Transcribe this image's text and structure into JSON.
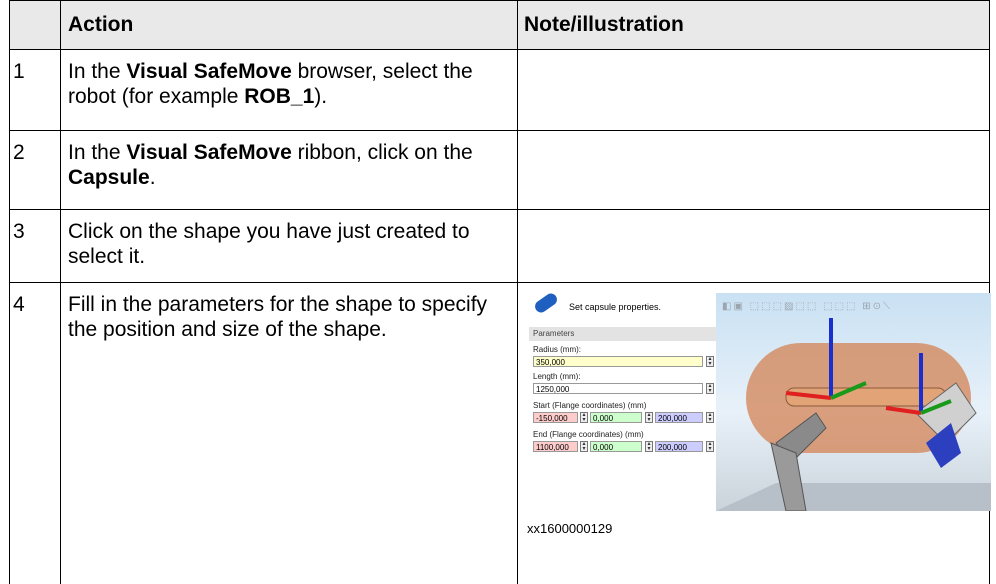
{
  "table": {
    "headers": [
      "",
      "Action",
      "Note/illustration"
    ],
    "rows": [
      {
        "num": "1",
        "parts": [
          "In the ",
          "Visual SafeMove",
          " browser, select the robot (for example ",
          "ROB_1",
          ")."
        ]
      },
      {
        "num": "2",
        "parts": [
          "In the ",
          "Visual SafeMove",
          " ribbon, click on the ",
          "Capsule",
          "."
        ]
      },
      {
        "num": "3",
        "parts": [
          "Click on the shape you have just created to select it."
        ]
      },
      {
        "num": "4",
        "parts": [
          "Fill in the parameters for the shape to specify the position and size of the shape."
        ]
      }
    ]
  },
  "figure": {
    "title": "Set capsule properties.",
    "section": "Parameters",
    "radius_label": "Radius (mm):",
    "radius_value": "350,000",
    "length_label": "Length (mm):",
    "length_value": "1250,000",
    "start_label": "Start (Flange coordinates) (mm)",
    "start_values": [
      "-150,000",
      "0,000",
      "200,000"
    ],
    "end_label": "End (Flange coordinates) (mm)",
    "end_values": [
      "1100,000",
      "0,000",
      "200,000"
    ],
    "caption": "xx1600000129",
    "colors": {
      "radius": "#ffffcc",
      "x": "#ffcccc",
      "y": "#ccffcc",
      "z": "#ccccff",
      "capsule": "#d4875a"
    }
  }
}
